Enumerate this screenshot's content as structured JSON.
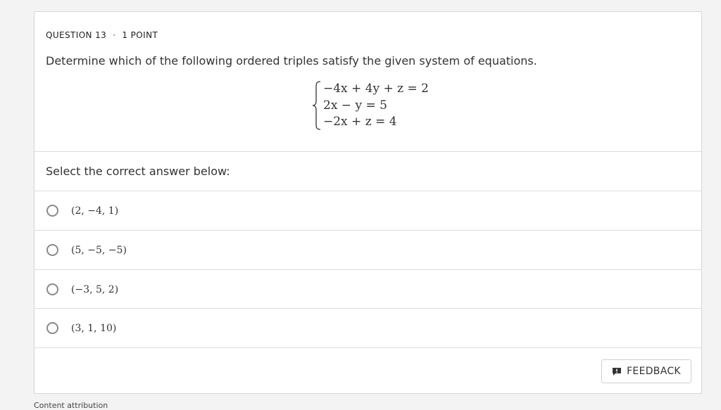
{
  "question": {
    "number_label": "QUESTION 13",
    "separator": "·",
    "points_label": "1 POINT",
    "prompt": "Determine which of the following ordered triples satisfy the given system of equations.",
    "equations": [
      "−4x + 4y + z = 2",
      "2x − y = 5",
      "−2x + z = 4"
    ]
  },
  "answers": {
    "instruction": "Select the correct answer below:",
    "options": [
      "(2, −4, 1)",
      "(5, −5, −5)",
      "(−3, 5, 2)",
      "(3, 1, 10)"
    ]
  },
  "feedback": {
    "label": "FEEDBACK",
    "icon": "feedback-icon"
  },
  "footer": {
    "attribution": "Content attribution"
  }
}
